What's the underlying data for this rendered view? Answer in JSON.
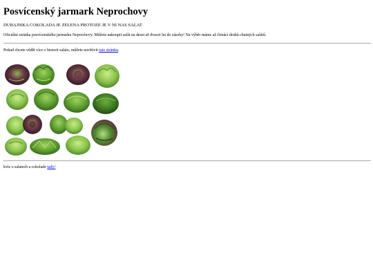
{
  "page": {
    "title": "Posvícenský jarmark Neprochovy",
    "subtitle": "DUBAJISKA COKOLADA JE ZELENA PROTOZE JE V NI NAS SALAT",
    "intro": "Oficiální stránka posvícenského jarmarku Neprochovy. Můžete nakoupit salát na deset až dvacet let do zásoby! Na výběr máme až čtrnáct druhů chutných salátů.",
    "history_text": "Pokud chcete vědět více o historii salátu, můžete navštívit ",
    "history_link": "tuto stránku",
    "history_end": ".",
    "quiz_text": "kviz o salatech a cokolade ",
    "quiz_link": "tady!"
  },
  "gallery": {
    "count": 14,
    "colors": {
      "green_dark": "#4f8a2b",
      "green_mid": "#7cb342",
      "green_light": "#a8d66a",
      "red_leaf": "#5a2a3a",
      "red_dark": "#3d1a26"
    }
  }
}
